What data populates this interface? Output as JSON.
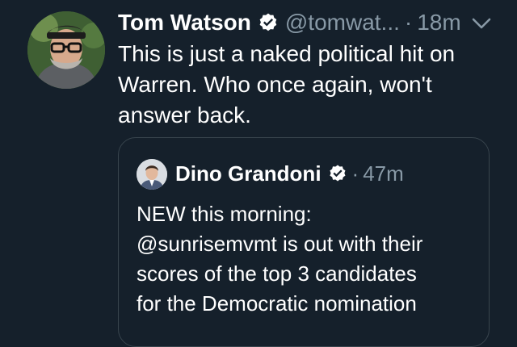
{
  "tweet": {
    "author_name": "Tom Watson",
    "handle": "@tomwat...",
    "separator": "·",
    "time": "18m",
    "text": "This is just a naked political hit on\nWarren. Who once again, won't\nanswer back.",
    "verified": true,
    "avatar_icon": "user-avatar",
    "menu_icon": "chevron-down-icon"
  },
  "quoted_tweet": {
    "author_name": "Dino Grandoni",
    "separator": "·",
    "time": "47m",
    "text": "NEW this morning:\n@sunrisemvmt is out with their\nscores of the top 3 candidates\nfor the Democratic nomination",
    "verified": true,
    "avatar_icon": "user-avatar"
  },
  "colors": {
    "background": "#15202b",
    "text_primary": "#ffffff",
    "text_secondary": "#8899a6",
    "border": "#38444d",
    "verified_badge": "#ffffff"
  }
}
